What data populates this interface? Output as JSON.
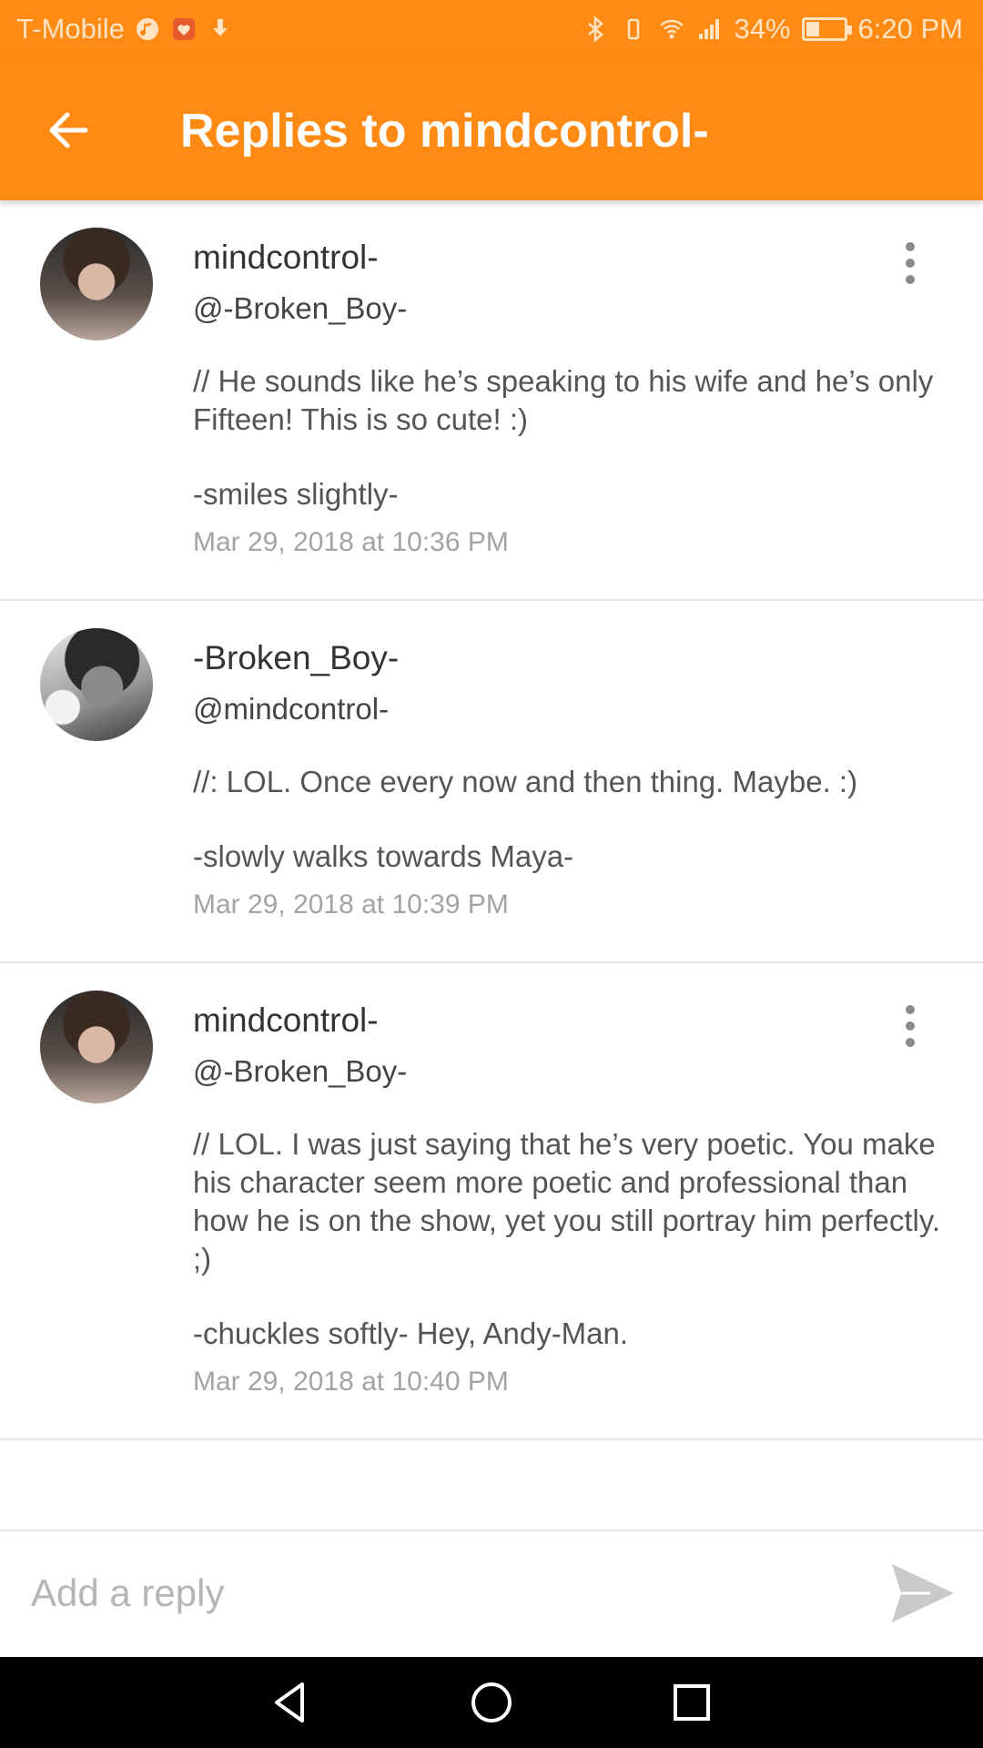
{
  "status_bar": {
    "carrier": "T-Mobile",
    "battery_percent": "34%",
    "battery_level": 0.34,
    "time": "6:20 PM",
    "icons": [
      "music-icon",
      "heart-app-icon",
      "download-icon",
      "bluetooth-icon",
      "vibrate-icon",
      "wifi-icon",
      "signal-icon",
      "battery-icon"
    ]
  },
  "app_bar": {
    "title": "Replies to mindcontrol-",
    "back_icon": "arrow-left-icon",
    "background": "#ff8a14"
  },
  "replies": [
    {
      "author": "mindcontrol-",
      "mention": "@-Broken_Boy-",
      "text": "// He sounds like he’s speaking to his wife and he’s only Fifteen! This is so cute! :)",
      "action": "-smiles slightly-",
      "timestamp": "Mar 29, 2018 at 10:36 PM",
      "has_menu": true
    },
    {
      "author": "-Broken_Boy-",
      "mention": "@mindcontrol-",
      "text": "//: LOL. Once every now and then thing. Maybe. :)",
      "action": "-slowly walks towards Maya-",
      "timestamp": "Mar 29, 2018 at 10:39 PM",
      "has_menu": false
    },
    {
      "author": "mindcontrol-",
      "mention": "@-Broken_Boy-",
      "text": "// LOL. I was just saying that he’s very poetic. You make his character seem more poetic and professional than how he is on the show, yet you still portray him perfectly. ;)",
      "action": "-chuckles softly- Hey, Andy-Man.",
      "timestamp": "Mar 29, 2018 at 10:40 PM",
      "has_menu": true
    }
  ],
  "reply_bar": {
    "placeholder": "Add a reply",
    "value": "",
    "send_icon": "send-icon"
  },
  "nav_bar": {
    "icons": [
      "back-triangle-icon",
      "home-circle-icon",
      "recents-square-icon"
    ]
  }
}
